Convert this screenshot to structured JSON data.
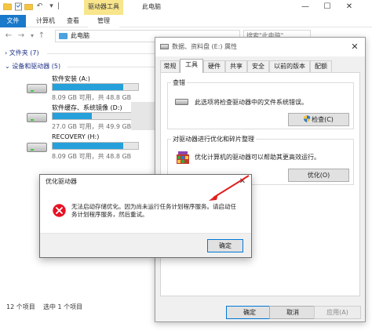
{
  "explorer": {
    "title_tools_tab": "驱动器工具",
    "title": "此电脑",
    "ribbon_tabs": [
      "文件",
      "计算机",
      "查看",
      "管理"
    ],
    "address": "此电脑",
    "search_placeholder": "搜索\"此电脑\"",
    "folders_group": "文件夹 (7)",
    "drives_group": "设备和驱动器 (5)",
    "drives": [
      {
        "name": "软件安装 (A:)",
        "free": "8.09 GB 可用，共 48.8 GB",
        "used_fraction": 0.83
      },
      {
        "name": "软件缓存、系统镜像 (D:)",
        "free": "27.0 GB 可用，共 49.9 GB",
        "used_fraction": 0.46
      },
      {
        "name": "RECOVERY (H:)",
        "free": "8.09 GB 可用，共 48.8 GB",
        "used_fraction": 0.83
      }
    ],
    "status_items": "12 个项目",
    "status_selected": "选中 1 个项目"
  },
  "properties": {
    "title": "数据、资料盘 (E:) 属性",
    "tabs": [
      "常规",
      "工具",
      "硬件",
      "共享",
      "安全",
      "以前的版本",
      "配额"
    ],
    "check_group": "查错",
    "check_desc": "此选项将检查驱动器中的文件系统错误。",
    "check_button": "检查(C)",
    "optimize_group": "对驱动器进行优化和碎片整理",
    "optimize_desc": "优化计算机的驱动器可以帮助其更高效运行。",
    "optimize_button": "优化(O)",
    "ok": "确定",
    "cancel": "取消",
    "apply": "应用(A)"
  },
  "error_dialog": {
    "title": "优化驱动器",
    "message": "无法启动存储优化。因为尚未运行任务计划程序服务。请启动任务计划程序服务，然后重试。",
    "ok": "确定"
  },
  "colors": {
    "accent": "#1979ca",
    "drive_bar": "#26a0da",
    "tools_tab": "#f8e58c",
    "error_red": "#e81123",
    "arrow": "#e02020"
  }
}
